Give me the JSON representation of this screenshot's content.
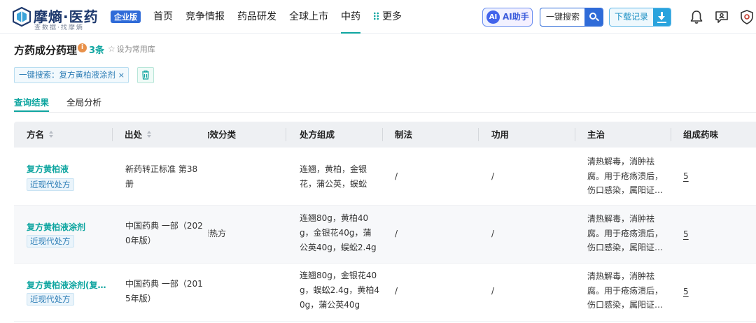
{
  "app": {
    "logo_name": "摩熵·医药",
    "logo_sub": "查数据·找摩熵",
    "edition_badge": "企业版"
  },
  "nav": {
    "items": [
      {
        "label": "首页"
      },
      {
        "label": "竞争情报"
      },
      {
        "label": "药品研发"
      },
      {
        "label": "全球上市"
      },
      {
        "label": "中药"
      },
      {
        "label": "更多"
      }
    ],
    "active_index": 4
  },
  "toolbar": {
    "ai_label": "AI助手",
    "ai_icon_text": "AI",
    "search_label": "一键搜索",
    "download_label": "下载记录"
  },
  "page": {
    "title": "方药成分药理",
    "count": "3条",
    "favorite_label": "设为常用库",
    "filter_tag": "一键搜索：复方黄柏液涂剂",
    "filter_close": "×"
  },
  "tabs": [
    {
      "label": "查询结果"
    },
    {
      "label": "全局分析"
    }
  ],
  "table": {
    "headers": [
      "方名",
      "出处",
      "功效分类",
      "处方组成",
      "制法",
      "功用",
      "主治",
      "组成药味"
    ],
    "rows": [
      {
        "name": "复方黄柏液",
        "type": "近现代处方",
        "source": [
          "新药转正标准 第38",
          "册"
        ],
        "category": "",
        "composition": [
          "连翘，黄柏，金银",
          "花，蒲公英，蜈蚣"
        ],
        "preparation": "/",
        "function": "/",
        "indication": [
          "清热解毒，消肿祛",
          "腐。用于疮疡溃后，",
          "伤口感染，属阳证…"
        ],
        "herb_count": "5"
      },
      {
        "name": "复方黄柏液涂剂",
        "type": "近现代处方",
        "source": [
          "中国药典 一部（202",
          "0年版）"
        ],
        "category": "清热方",
        "composition": [
          "连翘80g，黄柏40",
          "g，金银花40g，蒲",
          "公英40g，蜈蚣2.4g"
        ],
        "preparation": "/",
        "function": "/",
        "indication": [
          "清热解毒，消肿祛",
          "腐。用于疮疡溃后，",
          "伤口感染，属阳证…"
        ],
        "herb_count": "5"
      },
      {
        "name": "复方黄柏液涂剂(复…",
        "type": "近现代处方",
        "source": [
          "中国药典 一部（201",
          "5年版）"
        ],
        "category": "",
        "composition": [
          "连翘80g，金银花40",
          "g，蜈蚣2.4g，黄柏4",
          "0g，蒲公英40g"
        ],
        "preparation": "/",
        "function": "/",
        "indication": [
          "清热解毒，消肿祛",
          "腐。用于疮疡溃后，",
          "伤口感染，属阳证…"
        ],
        "herb_count": "5"
      }
    ]
  },
  "colors": {
    "accent": "#0ea5a0",
    "primary_blue": "#2f6bd8",
    "tag_blue": "#2b7cb5",
    "info_orange": "#e8914a"
  }
}
